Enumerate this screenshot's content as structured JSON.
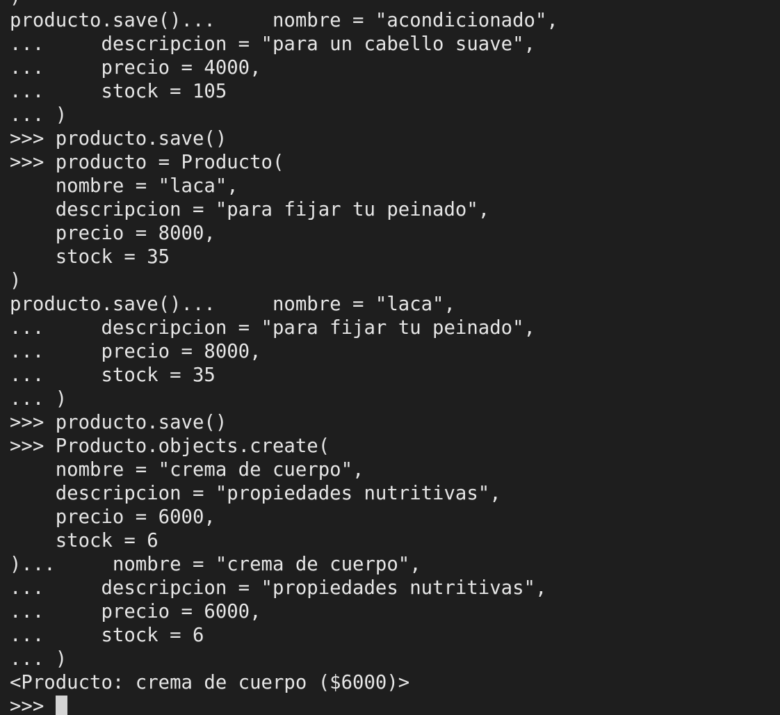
{
  "terminal": {
    "lines": [
      ")",
      "producto.save()...     nombre = \"acondicionado\",",
      "...     descripcion = \"para un cabello suave\",",
      "...     precio = 4000,",
      "...     stock = 105",
      "... )",
      ">>> producto.save()",
      ">>> producto = Producto(",
      "    nombre = \"laca\",",
      "    descripcion = \"para fijar tu peinado\",",
      "    precio = 8000,",
      "    stock = 35",
      ")",
      "producto.save()...     nombre = \"laca\",",
      "...     descripcion = \"para fijar tu peinado\",",
      "...     precio = 8000,",
      "...     stock = 35",
      "... )",
      ">>> producto.save()",
      ">>> Producto.objects.create(",
      "    nombre = \"crema de cuerpo\",",
      "    descripcion = \"propiedades nutritivas\",",
      "    precio = 6000,",
      "    stock = 6",
      ")...     nombre = \"crema de cuerpo\",",
      "...     descripcion = \"propiedades nutritivas\",",
      "...     precio = 6000,",
      "...     stock = 6",
      "... )",
      "<Producto: crema de cuerpo ($6000)>"
    ],
    "prompt": ">>> ",
    "colors": {
      "background": "#1e1e1e",
      "foreground": "#e6e6e6",
      "cursor": "#d4d4d4"
    }
  }
}
